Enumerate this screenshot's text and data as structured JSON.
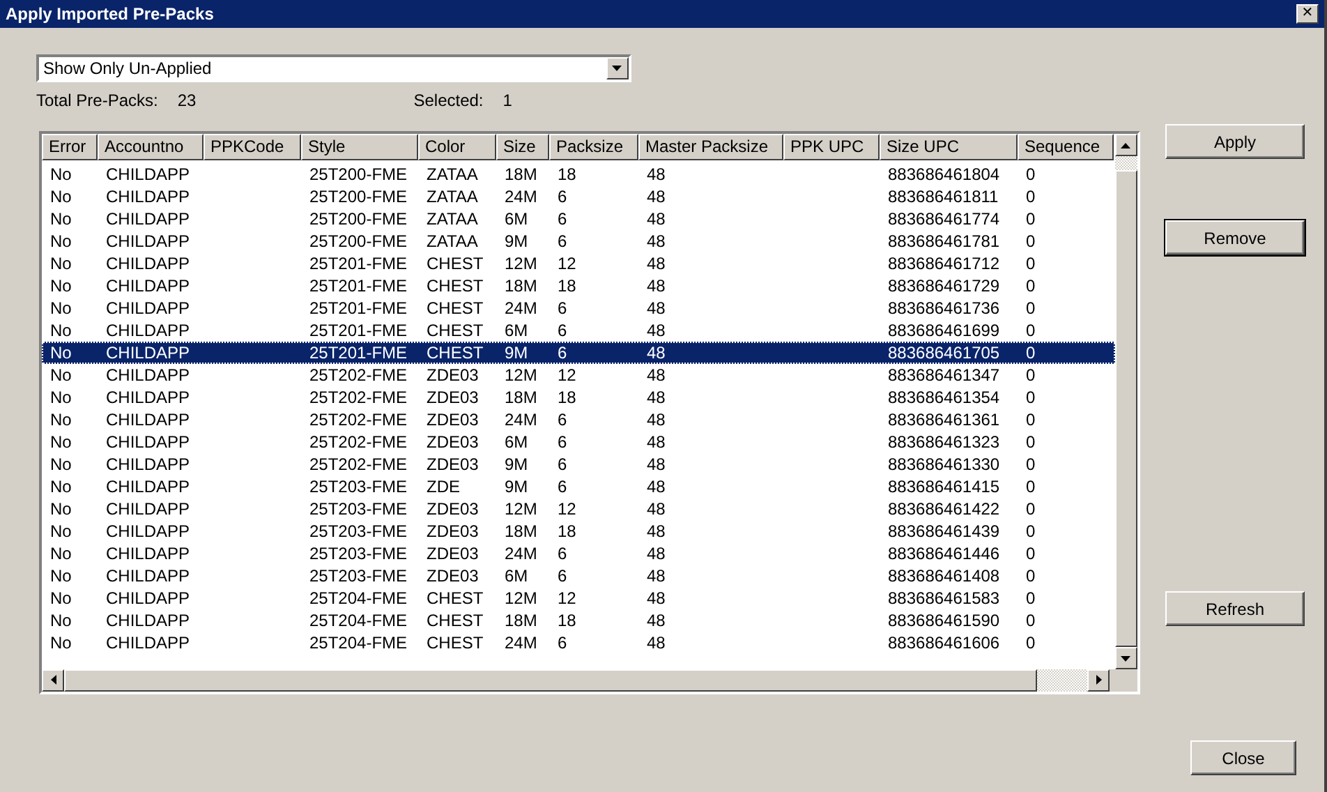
{
  "window": {
    "title": "Apply Imported Pre-Packs",
    "close_glyph": "✕"
  },
  "filter": {
    "value": "Show Only Un-Applied"
  },
  "summary": {
    "total_label": "Total Pre-Packs:",
    "total": "23",
    "selected_label": "Selected:",
    "selected": "1"
  },
  "table": {
    "columns": [
      "Error",
      "Accountno",
      "PPKCode",
      "Style",
      "Color",
      "Size",
      "Packsize",
      "Master Packsize",
      "PPK UPC",
      "Size UPC",
      "Sequence"
    ],
    "rows": [
      {
        "error": "No",
        "accountno": "CHILDAPP",
        "style": "25T200-FME",
        "color_name": "ZATAA",
        "size": "18M",
        "packsize": "18",
        "master_packsize": "48",
        "size_upc": "883686461804",
        "sequence": "0",
        "selected": false
      },
      {
        "error": "No",
        "accountno": "CHILDAPP",
        "style": "25T200-FME",
        "color_name": "ZATAA",
        "size": "24M",
        "packsize": "6",
        "master_packsize": "48",
        "size_upc": "883686461811",
        "sequence": "0",
        "selected": false
      },
      {
        "error": "No",
        "accountno": "CHILDAPP",
        "style": "25T200-FME",
        "color_name": "ZATAA",
        "size": "6M",
        "packsize": "6",
        "master_packsize": "48",
        "size_upc": "883686461774",
        "sequence": "0",
        "selected": false
      },
      {
        "error": "No",
        "accountno": "CHILDAPP",
        "style": "25T200-FME",
        "color_name": "ZATAA",
        "size": "9M",
        "packsize": "6",
        "master_packsize": "48",
        "size_upc": "883686461781",
        "sequence": "0",
        "selected": false
      },
      {
        "error": "No",
        "accountno": "CHILDAPP",
        "style": "25T201-FME",
        "color_name": "CHEST",
        "size": "12M",
        "packsize": "12",
        "master_packsize": "48",
        "size_upc": "883686461712",
        "sequence": "0",
        "selected": false
      },
      {
        "error": "No",
        "accountno": "CHILDAPP",
        "style": "25T201-FME",
        "color_name": "CHEST",
        "size": "18M",
        "packsize": "18",
        "master_packsize": "48",
        "size_upc": "883686461729",
        "sequence": "0",
        "selected": false
      },
      {
        "error": "No",
        "accountno": "CHILDAPP",
        "style": "25T201-FME",
        "color_name": "CHEST",
        "size": "24M",
        "packsize": "6",
        "master_packsize": "48",
        "size_upc": "883686461736",
        "sequence": "0",
        "selected": false
      },
      {
        "error": "No",
        "accountno": "CHILDAPP",
        "style": "25T201-FME",
        "color_name": "CHEST",
        "size": "6M",
        "packsize": "6",
        "master_packsize": "48",
        "size_upc": "883686461699",
        "sequence": "0",
        "selected": false
      },
      {
        "error": "No",
        "accountno": "CHILDAPP",
        "style": "25T201-FME",
        "color_name": "CHEST",
        "size": "9M",
        "packsize": "6",
        "master_packsize": "48",
        "size_upc": "883686461705",
        "sequence": "0",
        "selected": true
      },
      {
        "error": "No",
        "accountno": "CHILDAPP",
        "style": "25T202-FME",
        "color_name": "ZDE03",
        "size": "12M",
        "packsize": "12",
        "master_packsize": "48",
        "size_upc": "883686461347",
        "sequence": "0",
        "selected": false
      },
      {
        "error": "No",
        "accountno": "CHILDAPP",
        "style": "25T202-FME",
        "color_name": "ZDE03",
        "size": "18M",
        "packsize": "18",
        "master_packsize": "48",
        "size_upc": "883686461354",
        "sequence": "0",
        "selected": false
      },
      {
        "error": "No",
        "accountno": "CHILDAPP",
        "style": "25T202-FME",
        "color_name": "ZDE03",
        "size": "24M",
        "packsize": "6",
        "master_packsize": "48",
        "size_upc": "883686461361",
        "sequence": "0",
        "selected": false
      },
      {
        "error": "No",
        "accountno": "CHILDAPP",
        "style": "25T202-FME",
        "color_name": "ZDE03",
        "size": "6M",
        "packsize": "6",
        "master_packsize": "48",
        "size_upc": "883686461323",
        "sequence": "0",
        "selected": false
      },
      {
        "error": "No",
        "accountno": "CHILDAPP",
        "style": "25T202-FME",
        "color_name": "ZDE03",
        "size": "9M",
        "packsize": "6",
        "master_packsize": "48",
        "size_upc": "883686461330",
        "sequence": "0",
        "selected": false
      },
      {
        "error": "No",
        "accountno": "CHILDAPP",
        "style": "25T203-FME",
        "color_name": "ZDE",
        "size": "9M",
        "packsize": "6",
        "master_packsize": "48",
        "size_upc": "883686461415",
        "sequence": "0",
        "selected": false
      },
      {
        "error": "No",
        "accountno": "CHILDAPP",
        "style": "25T203-FME",
        "color_name": "ZDE03",
        "size": "12M",
        "packsize": "12",
        "master_packsize": "48",
        "size_upc": "883686461422",
        "sequence": "0",
        "selected": false
      },
      {
        "error": "No",
        "accountno": "CHILDAPP",
        "style": "25T203-FME",
        "color_name": "ZDE03",
        "size": "18M",
        "packsize": "18",
        "master_packsize": "48",
        "size_upc": "883686461439",
        "sequence": "0",
        "selected": false
      },
      {
        "error": "No",
        "accountno": "CHILDAPP",
        "style": "25T203-FME",
        "color_name": "ZDE03",
        "size": "24M",
        "packsize": "6",
        "master_packsize": "48",
        "size_upc": "883686461446",
        "sequence": "0",
        "selected": false
      },
      {
        "error": "No",
        "accountno": "CHILDAPP",
        "style": "25T203-FME",
        "color_name": "ZDE03",
        "size": "6M",
        "packsize": "6",
        "master_packsize": "48",
        "size_upc": "883686461408",
        "sequence": "0",
        "selected": false
      },
      {
        "error": "No",
        "accountno": "CHILDAPP",
        "style": "25T204-FME",
        "color_name": "CHEST",
        "size": "12M",
        "packsize": "12",
        "master_packsize": "48",
        "size_upc": "883686461583",
        "sequence": "0",
        "selected": false
      },
      {
        "error": "No",
        "accountno": "CHILDAPP",
        "style": "25T204-FME",
        "color_name": "CHEST",
        "size": "18M",
        "packsize": "18",
        "master_packsize": "48",
        "size_upc": "883686461590",
        "sequence": "0",
        "selected": false
      },
      {
        "error": "No",
        "accountno": "CHILDAPP",
        "style": "25T204-FME",
        "color_name": "CHEST",
        "size": "24M",
        "packsize": "6",
        "master_packsize": "48",
        "size_upc": "883686461606",
        "sequence": "0",
        "selected": false
      }
    ]
  },
  "buttons": {
    "apply": "Apply",
    "remove": "Remove",
    "refresh": "Refresh",
    "close": "Close"
  }
}
